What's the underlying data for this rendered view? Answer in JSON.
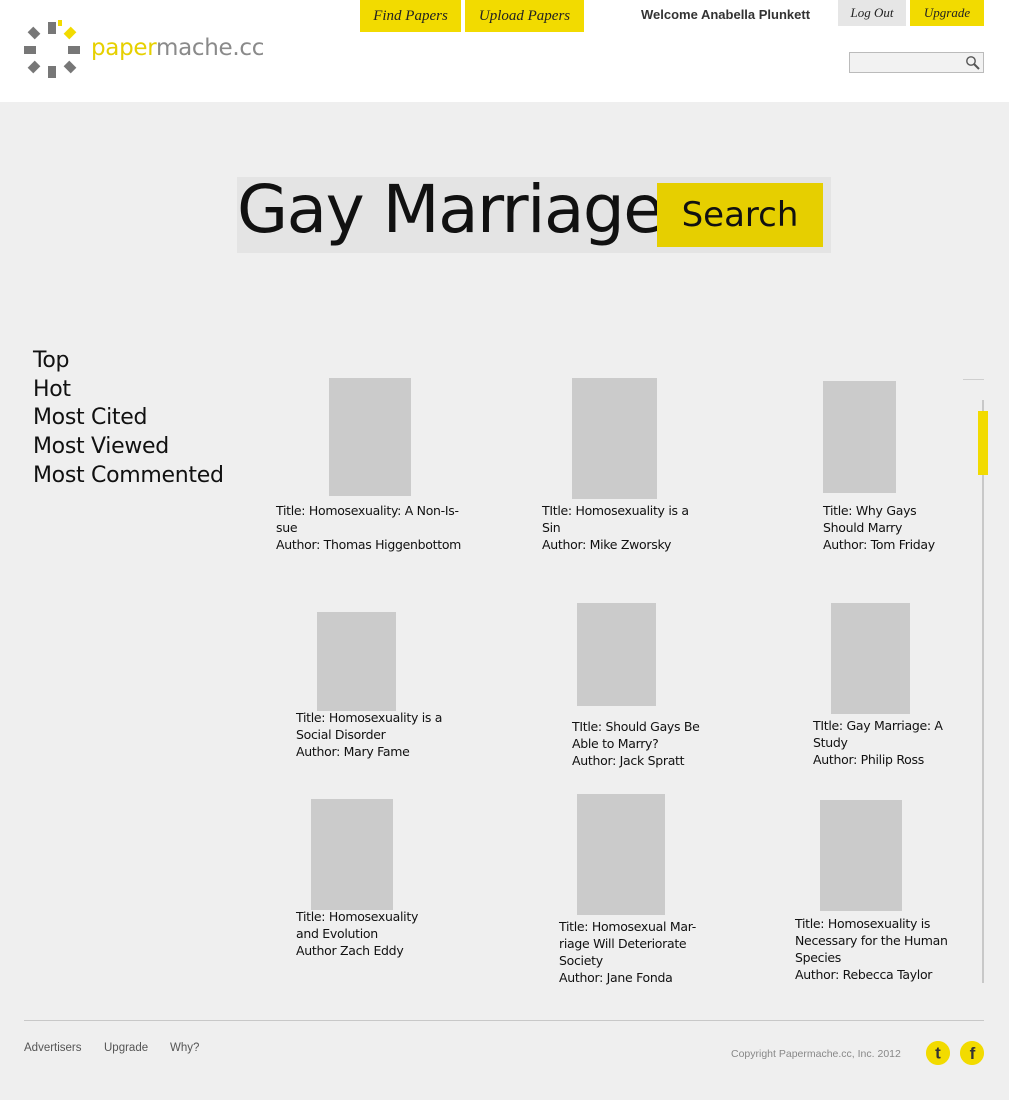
{
  "header": {
    "logo_text_a": "paper",
    "logo_text_b": "mache.cc",
    "nav": {
      "find_papers": "Find Papers",
      "upload_papers": "Upload Papers"
    },
    "welcome": "Welcome Anabella Plunkett",
    "logout": "Log Out",
    "upgrade": "Upgrade",
    "search_value": "",
    "search_placeholder": ""
  },
  "search": {
    "query": "Gay Marriage",
    "button": "Search"
  },
  "filters": [
    "Top",
    "Hot",
    "Most Cited",
    "Most Viewed",
    "Most Commented"
  ],
  "papers": [
    {
      "title_line": "Title: Homosexuality: A Non-Is-",
      "title_line2": "sue",
      "author_line": "Author: Thomas Higgenbottom"
    },
    {
      "title_line": "TItle: Homosexuality is a",
      "title_line2": "Sin",
      "author_line": "Author: Mike Zworsky"
    },
    {
      "title_line": "Title: Why Gays",
      "title_line2": "Should Marry",
      "author_line": "Author: Tom Friday"
    },
    {
      "title_line": "Title: Homosexuality is a",
      "title_line2": "Social Disorder",
      "author_line": "Author: Mary Fame"
    },
    {
      "title_line": "TItle: Should Gays Be",
      "title_line2": "Able to Marry?",
      "author_line": "Author: Jack Spratt"
    },
    {
      "title_line": "TItle: Gay Marriage: A",
      "title_line2": "Study",
      "author_line": "Author: Philip Ross"
    },
    {
      "title_line": "Title: Homosexuality",
      "title_line2": "and Evolution",
      "author_line": "Author Zach Eddy"
    },
    {
      "title_line": "Title: Homosexual Mar-",
      "title_line2": "riage Will Deteriorate",
      "title_line3": "Society",
      "author_line": "Author: Jane Fonda"
    },
    {
      "title_line": "Title: Homosexuality is",
      "title_line2": "Necessary for the Human",
      "title_line3": "Species",
      "author_line": "Author: Rebecca Taylor"
    }
  ],
  "footer": {
    "links": [
      "Advertisers",
      "Upgrade",
      "Why?"
    ],
    "copyright": "Copyright Papermache.cc, Inc. 2012",
    "social": {
      "twitter_glyph": "t",
      "facebook_glyph": "f"
    }
  },
  "colors": {
    "accent": "#f2db00",
    "placeholder": "#cbcbcb",
    "background": "#efefef"
  },
  "icons": [
    "logo-asterisk-icon",
    "magnifier-icon",
    "twitter-icon",
    "facebook-icon"
  ]
}
